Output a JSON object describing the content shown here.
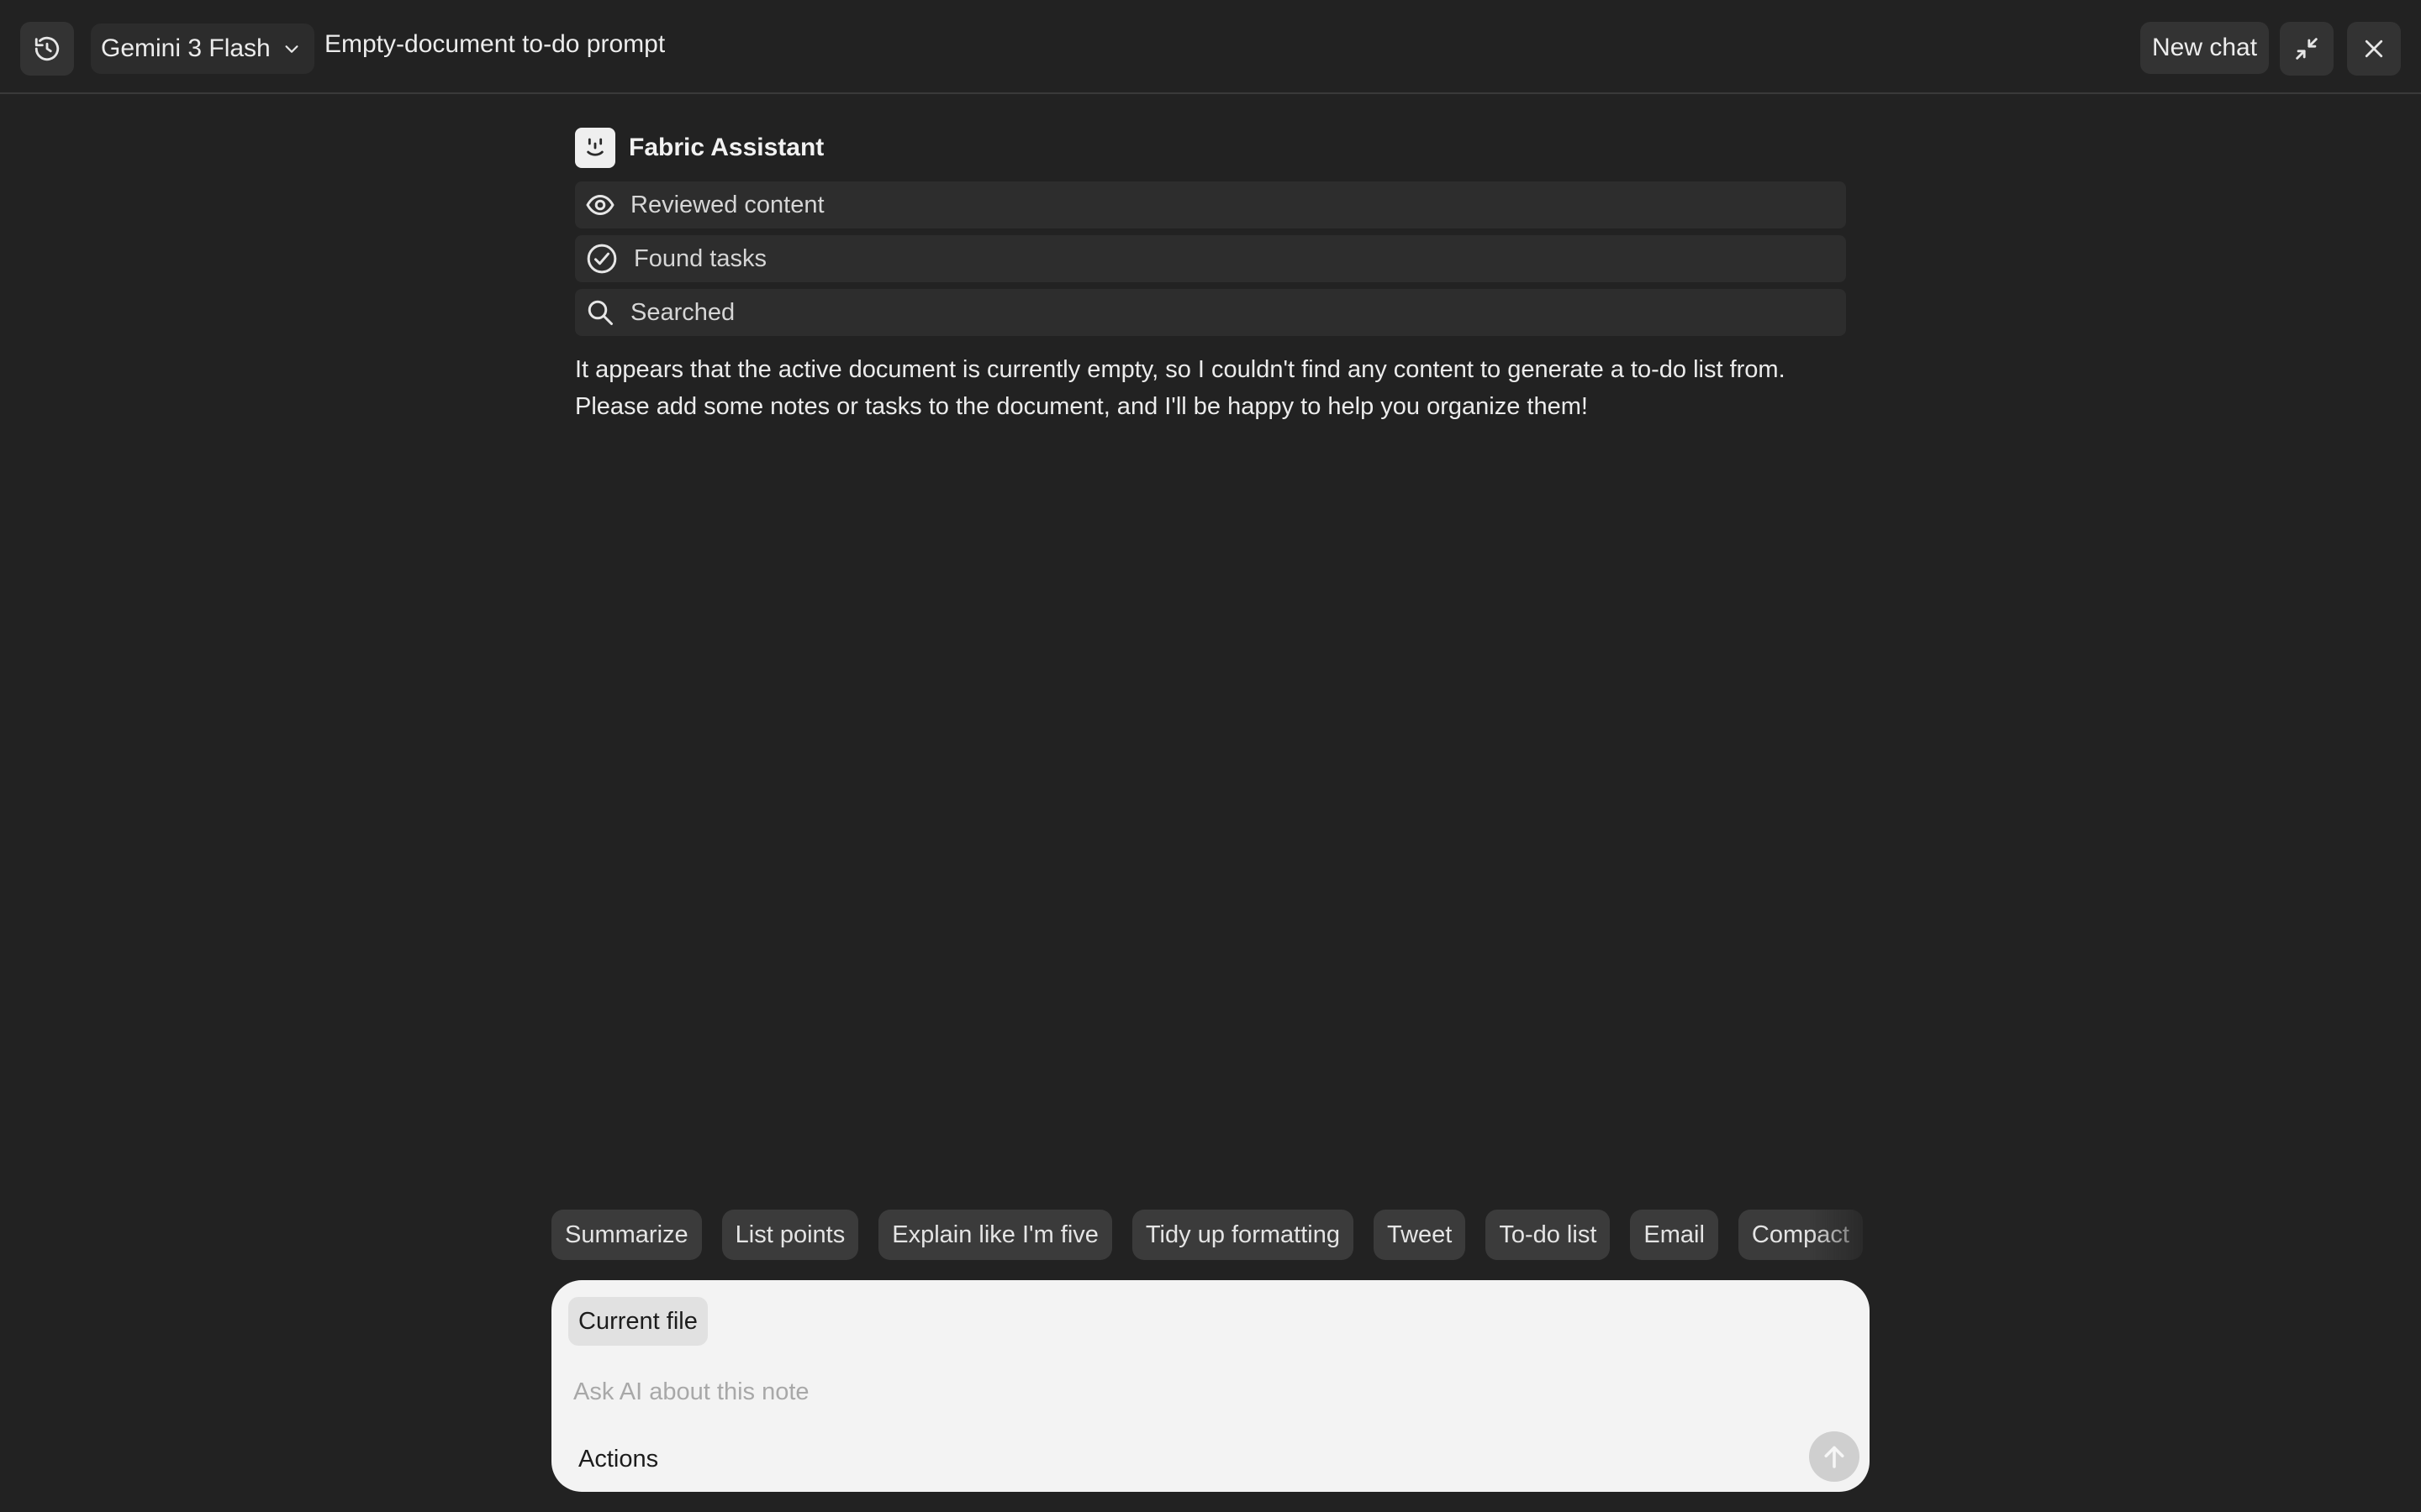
{
  "header": {
    "model": "Gemini 3 Flash",
    "title": "Empty-document to-do prompt",
    "new_chat_label": "New chat"
  },
  "message": {
    "author": "Fabric Assistant",
    "steps": [
      {
        "label": "Reviewed content",
        "icon": "eye-icon"
      },
      {
        "label": "Found tasks",
        "icon": "check-circle-icon"
      },
      {
        "label": "Searched",
        "icon": "search-icon"
      }
    ],
    "lines": [
      "It appears that the active document is currently empty, so I couldn't find any content to generate a to-do list from.",
      "Please add some notes or tasks to the document, and I'll be happy to help you organize them!"
    ]
  },
  "suggestions": [
    "Summarize",
    "List points",
    "Explain like I'm five",
    "Tidy up formatting",
    "Tweet",
    "To-do list",
    "Email",
    "Compact"
  ],
  "composer": {
    "context_chip": "Current file",
    "placeholder": "Ask AI about this note",
    "actions_label": "Actions"
  },
  "colors": {
    "background": "#222222",
    "surface": "#2d2d2d",
    "composer": "#f3f3f3",
    "chip": "#3b3b3b"
  }
}
